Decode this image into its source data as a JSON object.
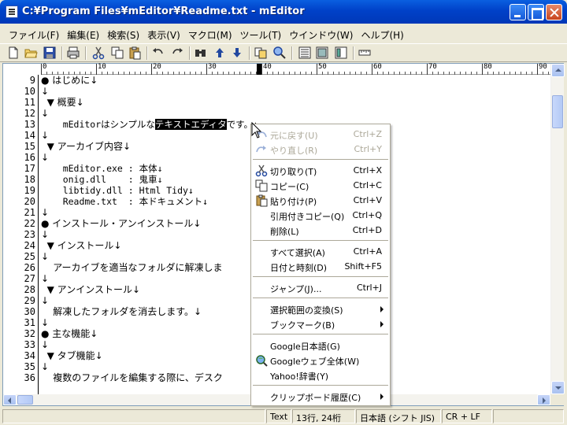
{
  "window": {
    "title": "C:¥Program Files¥mEditor¥Readme.txt - mEditor"
  },
  "menubar": [
    {
      "label": "ファイル(F)"
    },
    {
      "label": "編集(E)"
    },
    {
      "label": "検索(S)"
    },
    {
      "label": "表示(V)"
    },
    {
      "label": "マクロ(M)"
    },
    {
      "label": "ツール(T)"
    },
    {
      "label": "ウインドウ(W)"
    },
    {
      "label": "ヘルプ(H)"
    }
  ],
  "toolbar": {
    "buttons": [
      "new-file-icon",
      "open-folder-icon",
      "save-icon",
      "print-icon",
      "cut-icon",
      "copy-icon",
      "paste-icon",
      "undo-icon",
      "redo-icon",
      "find-icon",
      "find-up-icon",
      "find-down-icon",
      "replace-icon",
      "search-web-icon",
      "view-mode-1-icon",
      "view-mode-2-icon",
      "view-mode-3-icon",
      "ruler-icon"
    ]
  },
  "ruler": {
    "labels": [
      "0",
      "10",
      "20",
      "30",
      "40",
      "50",
      "60",
      "70",
      "80",
      "90"
    ]
  },
  "editor": {
    "line_numbers": [
      "9",
      "10",
      "11",
      "12",
      "13",
      "14",
      "15",
      "16",
      "17",
      "18",
      "19",
      "20",
      "21",
      "22",
      "23",
      "24",
      "25",
      "26",
      "27",
      "28",
      "29",
      "30",
      "31",
      "32",
      "33",
      "34",
      "35",
      "36"
    ],
    "lines": [
      "● はじめに↓",
      "↓",
      "  ▼ 概要↓",
      "↓",
      "    mEditorはシンプルな|テキストエディタ|です。↓",
      "↓",
      "  ▼ アーカイブ内容↓",
      "↓",
      "    mEditor.exe : 本体↓",
      "    onig.dll    : 鬼車↓",
      "    libtidy.dll : Html Tidy↓",
      "    Readme.txt  : 本ドキュメント↓",
      "↓",
      "● インストール・アンインストール↓",
      "↓",
      "  ▼ インストール↓",
      "↓",
      "    アーカイブを適当なフォルダに解凍しま",
      "↓",
      "  ▼ アンインストール↓",
      "↓",
      "    解凍したフォルダを消去します。↓",
      "↓",
      "● 主な機能↓",
      "↓",
      "  ▼ タブ機能↓",
      "↓",
      "    複数のファイルを編集する際に、デスク"
    ],
    "selected_text": "テキストエディタ"
  },
  "context_menu": {
    "items": [
      {
        "label": "元に戻す(U)",
        "accel": "Ctrl+Z",
        "disabled": true,
        "icon": "undo-icon"
      },
      {
        "label": "やり直し(R)",
        "accel": "Ctrl+Y",
        "disabled": true,
        "icon": "redo-icon"
      },
      {
        "sep": true
      },
      {
        "label": "切り取り(T)",
        "accel": "Ctrl+X",
        "icon": "cut-icon"
      },
      {
        "label": "コピー(C)",
        "accel": "Ctrl+C",
        "icon": "copy-icon"
      },
      {
        "label": "貼り付け(P)",
        "accel": "Ctrl+V",
        "icon": "paste-icon"
      },
      {
        "label": "引用付きコピー(Q)",
        "accel": "Ctrl+Q"
      },
      {
        "label": "削除(L)",
        "accel": "Ctrl+D"
      },
      {
        "sep": true
      },
      {
        "label": "すべて選択(A)",
        "accel": "Ctrl+A"
      },
      {
        "label": "日付と時刻(D)",
        "accel": "Shift+F5"
      },
      {
        "sep": true
      },
      {
        "label": "ジャンプ(J)...",
        "accel": "Ctrl+J"
      },
      {
        "sep": true
      },
      {
        "label": "選択範囲の変換(S)",
        "submenu": true
      },
      {
        "label": "ブックマーク(B)",
        "submenu": true
      },
      {
        "sep": true
      },
      {
        "label": "Google日本語(G)"
      },
      {
        "label": "Googleウェブ全体(W)",
        "icon": "google-search-icon"
      },
      {
        "label": "Yahoo!辞書(Y)"
      },
      {
        "sep": true
      },
      {
        "label": "クリップボード履歴(C)",
        "submenu": true
      }
    ]
  },
  "statusbar": {
    "mode": "Text",
    "position": "13行, 24桁",
    "encoding": "日本語 (シフト JIS)",
    "line_ending": "CR + LF"
  }
}
